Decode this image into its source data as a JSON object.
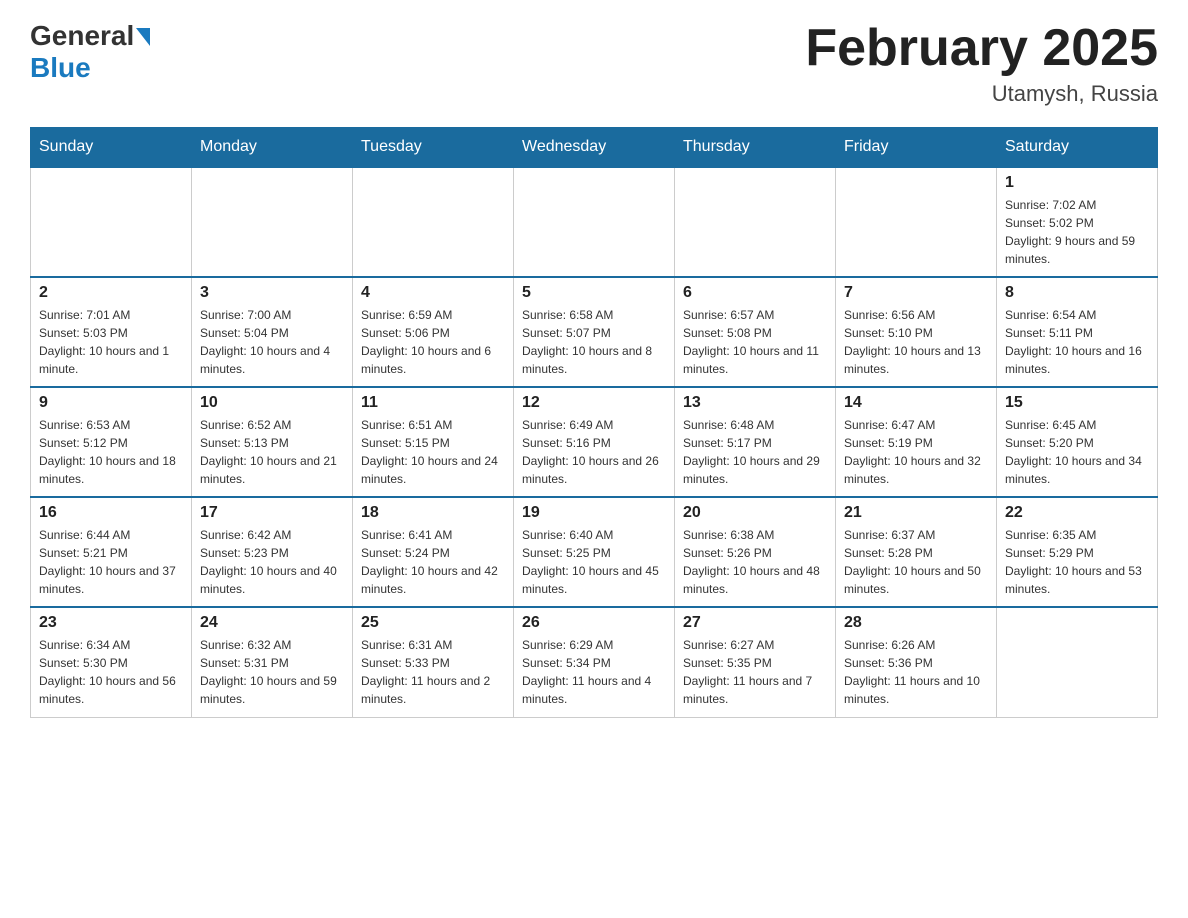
{
  "header": {
    "logo": {
      "general": "General",
      "blue": "Blue"
    },
    "title": "February 2025",
    "subtitle": "Utamysh, Russia"
  },
  "days_of_week": [
    "Sunday",
    "Monday",
    "Tuesday",
    "Wednesday",
    "Thursday",
    "Friday",
    "Saturday"
  ],
  "weeks": [
    [
      {
        "day": "",
        "info": ""
      },
      {
        "day": "",
        "info": ""
      },
      {
        "day": "",
        "info": ""
      },
      {
        "day": "",
        "info": ""
      },
      {
        "day": "",
        "info": ""
      },
      {
        "day": "",
        "info": ""
      },
      {
        "day": "1",
        "info": "Sunrise: 7:02 AM\nSunset: 5:02 PM\nDaylight: 9 hours and 59 minutes."
      }
    ],
    [
      {
        "day": "2",
        "info": "Sunrise: 7:01 AM\nSunset: 5:03 PM\nDaylight: 10 hours and 1 minute."
      },
      {
        "day": "3",
        "info": "Sunrise: 7:00 AM\nSunset: 5:04 PM\nDaylight: 10 hours and 4 minutes."
      },
      {
        "day": "4",
        "info": "Sunrise: 6:59 AM\nSunset: 5:06 PM\nDaylight: 10 hours and 6 minutes."
      },
      {
        "day": "5",
        "info": "Sunrise: 6:58 AM\nSunset: 5:07 PM\nDaylight: 10 hours and 8 minutes."
      },
      {
        "day": "6",
        "info": "Sunrise: 6:57 AM\nSunset: 5:08 PM\nDaylight: 10 hours and 11 minutes."
      },
      {
        "day": "7",
        "info": "Sunrise: 6:56 AM\nSunset: 5:10 PM\nDaylight: 10 hours and 13 minutes."
      },
      {
        "day": "8",
        "info": "Sunrise: 6:54 AM\nSunset: 5:11 PM\nDaylight: 10 hours and 16 minutes."
      }
    ],
    [
      {
        "day": "9",
        "info": "Sunrise: 6:53 AM\nSunset: 5:12 PM\nDaylight: 10 hours and 18 minutes."
      },
      {
        "day": "10",
        "info": "Sunrise: 6:52 AM\nSunset: 5:13 PM\nDaylight: 10 hours and 21 minutes."
      },
      {
        "day": "11",
        "info": "Sunrise: 6:51 AM\nSunset: 5:15 PM\nDaylight: 10 hours and 24 minutes."
      },
      {
        "day": "12",
        "info": "Sunrise: 6:49 AM\nSunset: 5:16 PM\nDaylight: 10 hours and 26 minutes."
      },
      {
        "day": "13",
        "info": "Sunrise: 6:48 AM\nSunset: 5:17 PM\nDaylight: 10 hours and 29 minutes."
      },
      {
        "day": "14",
        "info": "Sunrise: 6:47 AM\nSunset: 5:19 PM\nDaylight: 10 hours and 32 minutes."
      },
      {
        "day": "15",
        "info": "Sunrise: 6:45 AM\nSunset: 5:20 PM\nDaylight: 10 hours and 34 minutes."
      }
    ],
    [
      {
        "day": "16",
        "info": "Sunrise: 6:44 AM\nSunset: 5:21 PM\nDaylight: 10 hours and 37 minutes."
      },
      {
        "day": "17",
        "info": "Sunrise: 6:42 AM\nSunset: 5:23 PM\nDaylight: 10 hours and 40 minutes."
      },
      {
        "day": "18",
        "info": "Sunrise: 6:41 AM\nSunset: 5:24 PM\nDaylight: 10 hours and 42 minutes."
      },
      {
        "day": "19",
        "info": "Sunrise: 6:40 AM\nSunset: 5:25 PM\nDaylight: 10 hours and 45 minutes."
      },
      {
        "day": "20",
        "info": "Sunrise: 6:38 AM\nSunset: 5:26 PM\nDaylight: 10 hours and 48 minutes."
      },
      {
        "day": "21",
        "info": "Sunrise: 6:37 AM\nSunset: 5:28 PM\nDaylight: 10 hours and 50 minutes."
      },
      {
        "day": "22",
        "info": "Sunrise: 6:35 AM\nSunset: 5:29 PM\nDaylight: 10 hours and 53 minutes."
      }
    ],
    [
      {
        "day": "23",
        "info": "Sunrise: 6:34 AM\nSunset: 5:30 PM\nDaylight: 10 hours and 56 minutes."
      },
      {
        "day": "24",
        "info": "Sunrise: 6:32 AM\nSunset: 5:31 PM\nDaylight: 10 hours and 59 minutes."
      },
      {
        "day": "25",
        "info": "Sunrise: 6:31 AM\nSunset: 5:33 PM\nDaylight: 11 hours and 2 minutes."
      },
      {
        "day": "26",
        "info": "Sunrise: 6:29 AM\nSunset: 5:34 PM\nDaylight: 11 hours and 4 minutes."
      },
      {
        "day": "27",
        "info": "Sunrise: 6:27 AM\nSunset: 5:35 PM\nDaylight: 11 hours and 7 minutes."
      },
      {
        "day": "28",
        "info": "Sunrise: 6:26 AM\nSunset: 5:36 PM\nDaylight: 11 hours and 10 minutes."
      },
      {
        "day": "",
        "info": ""
      }
    ]
  ]
}
